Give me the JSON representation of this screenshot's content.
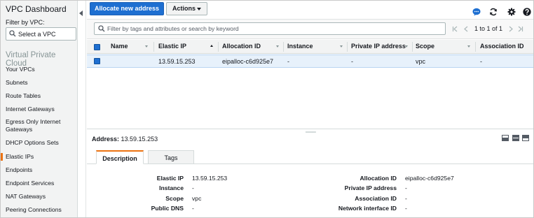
{
  "sidebar": {
    "title": "VPC Dashboard",
    "filter_label": "Filter by VPC:",
    "select_placeholder": "Select a VPC",
    "section": "Virtual Private Cloud",
    "items": [
      {
        "label": "Your VPCs"
      },
      {
        "label": "Subnets"
      },
      {
        "label": "Route Tables"
      },
      {
        "label": "Internet Gateways"
      },
      {
        "label": "Egress Only Internet Gateways"
      },
      {
        "label": "DHCP Options Sets"
      },
      {
        "label": "Elastic IPs",
        "active": true
      },
      {
        "label": "Endpoints"
      },
      {
        "label": "Endpoint Services"
      },
      {
        "label": "NAT Gateways"
      },
      {
        "label": "Peering Connections"
      }
    ]
  },
  "toolbar": {
    "allocate_label": "Allocate new address",
    "actions_label": "Actions",
    "icons": [
      "chat-icon",
      "refresh-icon",
      "gear-icon",
      "help-icon"
    ]
  },
  "filter": {
    "placeholder": "Filter by tags and attributes or search by keyword",
    "pagination": "1 to 1 of 1"
  },
  "table": {
    "columns": [
      "Name",
      "Elastic IP",
      "Allocation ID",
      "Instance",
      "Private IP address",
      "Scope",
      "Association ID"
    ],
    "rows": [
      {
        "name": "",
        "elastic_ip": "13.59.15.253",
        "allocation_id": "eipalloc-c6d925e7",
        "instance": "-",
        "private_ip": "-",
        "scope": "vpc",
        "association_id": "-"
      }
    ]
  },
  "detail": {
    "address_label": "Address:",
    "address_value": "13.59.15.253",
    "tabs": [
      "Description",
      "Tags"
    ],
    "left": [
      {
        "label": "Elastic IP",
        "value": "13.59.15.253"
      },
      {
        "label": "Instance",
        "value": "-"
      },
      {
        "label": "Scope",
        "value": "vpc"
      },
      {
        "label": "Public DNS",
        "value": "-"
      }
    ],
    "right": [
      {
        "label": "Allocation ID",
        "value": "eipalloc-c6d925e7"
      },
      {
        "label": "Private IP address",
        "value": "-"
      },
      {
        "label": "Association ID",
        "value": "-"
      },
      {
        "label": "Network interface ID",
        "value": "-"
      }
    ]
  },
  "colors": {
    "primary": "#1e6fd1",
    "accent": "#ec7211",
    "selected_row": "#e7f1fb"
  }
}
